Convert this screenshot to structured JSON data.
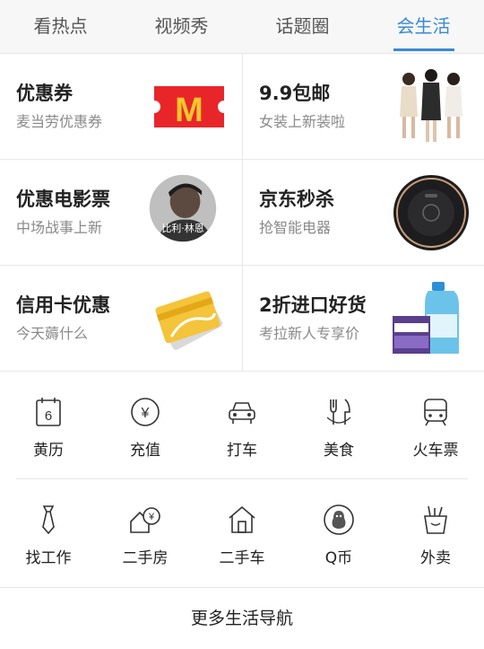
{
  "tabs": [
    {
      "label": "看热点"
    },
    {
      "label": "视频秀"
    },
    {
      "label": "话题圈"
    },
    {
      "label": "会生活"
    }
  ],
  "promos": [
    {
      "title": "优惠券",
      "subtitle": "麦当劳优惠券",
      "image": "mcdonalds-coupon-icon",
      "logo_text": "M"
    },
    {
      "title": "9.9包邮",
      "subtitle": "女装上新装啦",
      "image": "fashion-models-image"
    },
    {
      "title": "优惠电影票",
      "subtitle": "中场战事上新",
      "image": "movie-poster-image",
      "poster_text": "比利·林恩"
    },
    {
      "title": "京东秒杀",
      "subtitle": "抢智能电器",
      "image": "robot-vacuum-image"
    },
    {
      "title": "信用卡优惠",
      "subtitle": "今天薅什么",
      "image": "credit-card-image"
    },
    {
      "title": "2折进口好货",
      "subtitle": "考拉新人专享价",
      "image": "imported-goods-image"
    }
  ],
  "services_row1": [
    {
      "label": "黄历",
      "icon": "calendar-icon",
      "icon_text": "6"
    },
    {
      "label": "充值",
      "icon": "yen-coin-icon",
      "icon_text": "¥"
    },
    {
      "label": "打车",
      "icon": "taxi-icon"
    },
    {
      "label": "美食",
      "icon": "fork-knife-icon"
    },
    {
      "label": "火车票",
      "icon": "train-icon"
    }
  ],
  "services_row2": [
    {
      "label": "找工作",
      "icon": "tie-icon"
    },
    {
      "label": "二手房",
      "icon": "house-yen-icon",
      "icon_text": "¥"
    },
    {
      "label": "二手车",
      "icon": "home-icon"
    },
    {
      "label": "Q币",
      "icon": "qq-penguin-icon"
    },
    {
      "label": "外卖",
      "icon": "takeout-icon"
    }
  ],
  "more_label": "更多生活导航",
  "colors": {
    "accent": "#3a8ad3",
    "mcd_red": "#e8262a",
    "mcd_yellow": "#ffc72c"
  }
}
